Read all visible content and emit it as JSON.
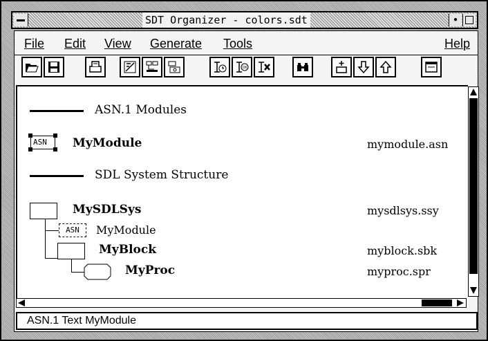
{
  "window": {
    "title": "SDT Organizer - colors.sdt"
  },
  "menubar": {
    "file": "File",
    "edit": "Edit",
    "view": "View",
    "generate": "Generate",
    "tools": "Tools",
    "help": "Help"
  },
  "toolbar": {
    "icons": [
      "open-folder-icon",
      "save-icon",
      "print-icon",
      "edit-diagram-icon",
      "diagram-tree-icon",
      "diagram-file-icon",
      "timer-icon",
      "check-ok-icon",
      "delete-diagram-icon",
      "binoculars-icon",
      "add-icon",
      "arrow-down-icon",
      "arrow-up-icon",
      "window-icon"
    ]
  },
  "tree": {
    "asn_section": "ASN.1 Modules",
    "asn_badge": "ASN",
    "module_name": "MyModule",
    "module_file": "mymodule.asn",
    "sdl_section": "SDL System Structure",
    "system_name": "MySDLSys",
    "system_file": "mysdlsys.ssy",
    "ref_badge": "ASN",
    "ref_name": "MyModule",
    "block_name": "MyBlock",
    "block_file": "myblock.sbk",
    "proc_name": "MyProc",
    "proc_file": "myproc.spr"
  },
  "status": {
    "text": "ASN.1 Text MyModule"
  }
}
